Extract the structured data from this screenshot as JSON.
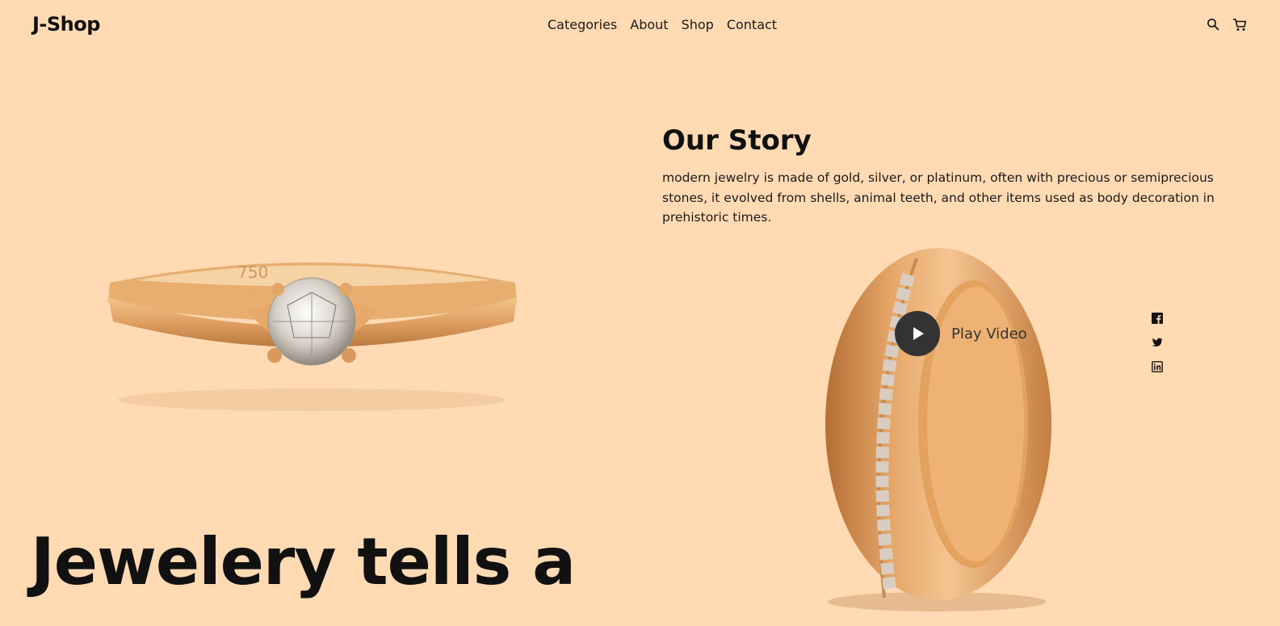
{
  "header": {
    "logo": "J-Shop",
    "nav": [
      "Categories",
      "About",
      "Shop",
      "Contact"
    ],
    "icons": [
      "search-icon",
      "cart-icon"
    ]
  },
  "story": {
    "title": "Our Story",
    "text": "modern jewelry is made of gold, silver, or platinum, often with precious or semiprecious stones, it evolved from shells, animal teeth, and other items used as body decoration in prehistoric times."
  },
  "ring_engraving": "750",
  "video": {
    "label": "Play Video"
  },
  "social": [
    "facebook-icon",
    "twitter-icon",
    "linkedin-icon"
  ],
  "hero": {
    "headline": "Jewelery tells a"
  },
  "colors": {
    "background": "#FFDAB3",
    "text": "#111111",
    "play_button": "#333333",
    "gold": "#E1A062"
  }
}
